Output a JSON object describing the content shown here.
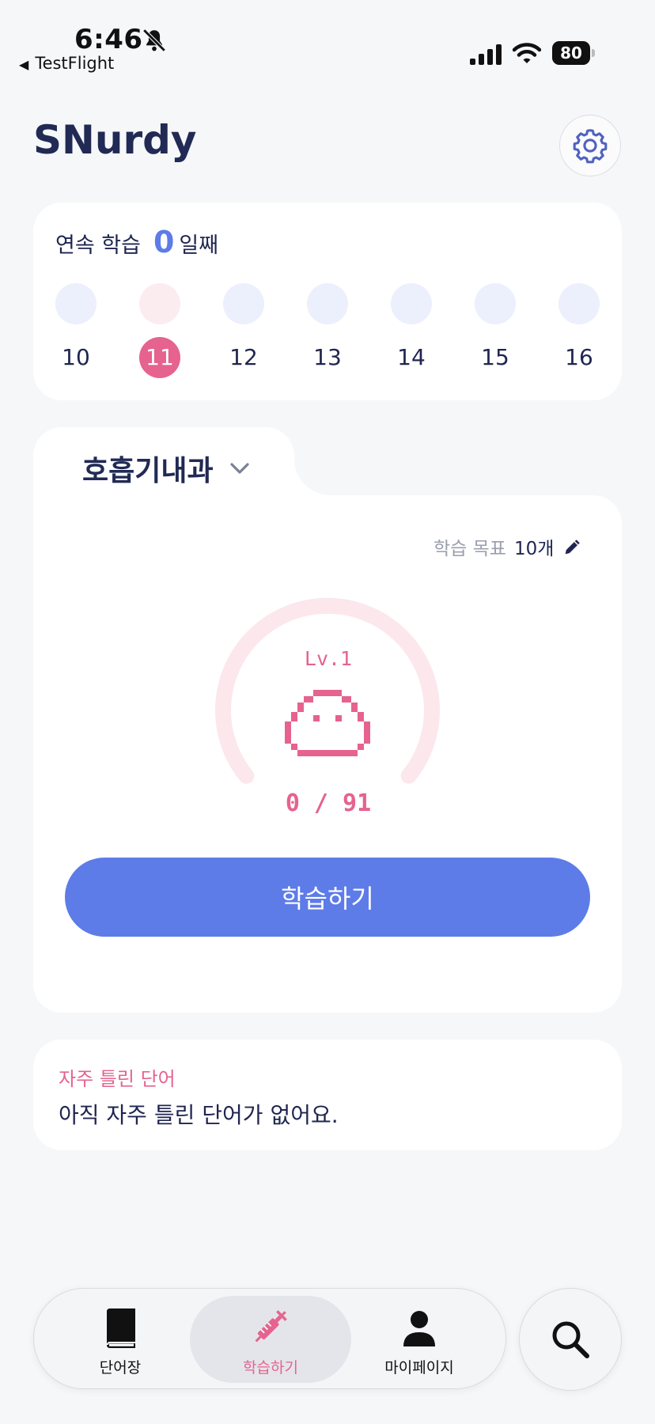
{
  "status_bar": {
    "time": "6:46",
    "back_app": "TestFlight",
    "battery": "80",
    "icons": [
      "bell-slash-icon",
      "signal-icon",
      "wifi-icon",
      "battery-icon"
    ]
  },
  "header": {
    "title": "SNurdy",
    "settings_icon": "gear-icon"
  },
  "streak": {
    "label_prefix": "연속 학습",
    "count": "0",
    "label_suffix": "일째",
    "days": [
      {
        "num": "10",
        "today": false
      },
      {
        "num": "11",
        "today": true
      },
      {
        "num": "12",
        "today": false
      },
      {
        "num": "13",
        "today": false
      },
      {
        "num": "14",
        "today": false
      },
      {
        "num": "15",
        "today": false
      },
      {
        "num": "16",
        "today": false
      }
    ]
  },
  "study": {
    "subject": "호흡기내과",
    "goal_label": "학습 목표",
    "goal_value": "10개",
    "level": "Lv.1",
    "progress_text": "0 / 91",
    "progress_value": 0,
    "progress_total": 91,
    "button_label": "학습하기"
  },
  "wrong_words": {
    "title": "자주 틀린 단어",
    "empty_text": "아직 자주 틀린 단어가 없어요."
  },
  "bottom_nav": {
    "items": [
      {
        "label": "단어장",
        "icon": "book-icon",
        "active": false
      },
      {
        "label": "학습하기",
        "icon": "syringe-icon",
        "active": true
      },
      {
        "label": "마이페이지",
        "icon": "person-icon",
        "active": false
      }
    ],
    "search_icon": "search-icon"
  },
  "colors": {
    "accent_blue": "#5d7ce8",
    "accent_pink": "#e5638e",
    "navy": "#1f2550",
    "background": "#f6f7f8"
  }
}
